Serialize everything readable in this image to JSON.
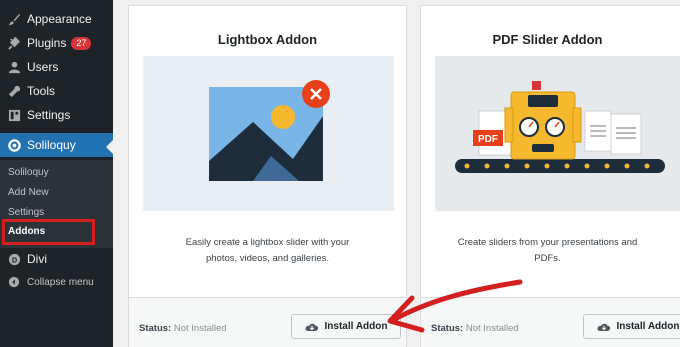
{
  "sidebar": {
    "items": [
      {
        "label": "Appearance",
        "icon": "paintbrush-icon"
      },
      {
        "label": "Plugins",
        "icon": "plug-icon",
        "badge": "27"
      },
      {
        "label": "Users",
        "icon": "user-icon"
      },
      {
        "label": "Tools",
        "icon": "wrench-icon"
      },
      {
        "label": "Settings",
        "icon": "settings-icon"
      },
      {
        "label": "Soliloquy",
        "icon": "soliloquy-icon"
      },
      {
        "label": "Divi",
        "icon": "divi-icon"
      },
      {
        "label": "Collapse menu",
        "icon": "collapse-icon"
      }
    ],
    "submenu": [
      "Soliloquy",
      "Add New",
      "Settings",
      "Addons"
    ]
  },
  "cards": [
    {
      "title": "Lightbox Addon",
      "description_line1": "Easily create a lightbox slider with your",
      "description_line2": "photos, videos, and galleries.",
      "status_label": "Status:",
      "status_value": "Not Installed",
      "button_label": "Install Addon"
    },
    {
      "title": "PDF Slider Addon",
      "description_line1": "Create sliders from your presentations and",
      "description_line2": "PDFs.",
      "image_text": "PDF",
      "status_label": "Status:",
      "status_value": "Not Installed",
      "button_label": "Install Addon"
    }
  ],
  "colors": {
    "sidebar_bg": "#1d2327",
    "active_blue": "#2271b1",
    "badge_red": "#d63638",
    "annotation_red": "#d41f1f",
    "machine_yellow": "#f5b82e"
  }
}
